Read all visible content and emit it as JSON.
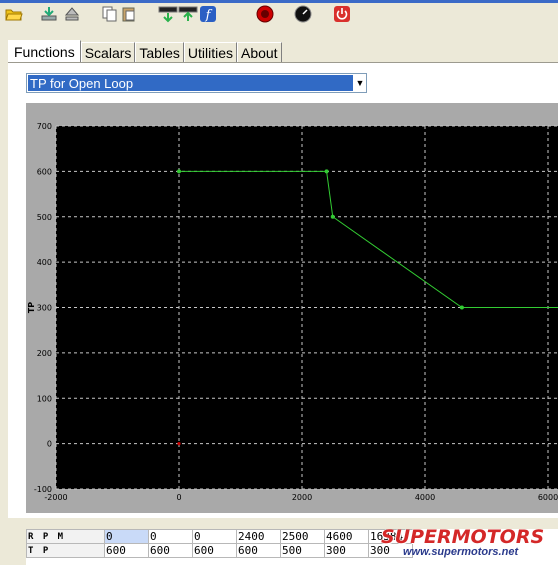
{
  "toolbar": {
    "buttons": [
      {
        "name": "open-folder",
        "icon": "folder-open-icon"
      },
      {
        "name": "download",
        "icon": "download-icon"
      },
      {
        "name": "eject",
        "icon": "eject-icon"
      },
      {
        "name": "copy",
        "icon": "copy-icon"
      },
      {
        "name": "paste",
        "icon": "paste-icon"
      },
      {
        "name": "program-chip",
        "icon": "chip-program-icon"
      },
      {
        "name": "read-chip",
        "icon": "chip-read-icon"
      },
      {
        "name": "function",
        "icon": "function-f-icon"
      },
      {
        "name": "stop",
        "icon": "stop-icon"
      },
      {
        "name": "gauge",
        "icon": "gauge-icon"
      },
      {
        "name": "power",
        "icon": "power-icon"
      }
    ]
  },
  "tabs": [
    {
      "label": "Functions",
      "active": true
    },
    {
      "label": "Scalars",
      "active": false
    },
    {
      "label": "Tables",
      "active": false
    },
    {
      "label": "Utilities",
      "active": false
    },
    {
      "label": "About",
      "active": false
    }
  ],
  "selector": {
    "value": "TP for Open Loop"
  },
  "chart_data": {
    "type": "line",
    "ylabel": "TP",
    "xlim": [
      -2000,
      6000
    ],
    "ylim": [
      -100,
      700
    ],
    "xticks": [
      "-2000",
      "0",
      "2000",
      "4000",
      "6000"
    ],
    "yticks": [
      "-100",
      "0",
      "100",
      "200",
      "300",
      "400",
      "500",
      "600",
      "700"
    ],
    "grid": true,
    "background": "#000000",
    "line_color": "#33cc33",
    "series": [
      {
        "points": [
          {
            "x": 0,
            "y": 600
          },
          {
            "x": 2400,
            "y": 600
          },
          {
            "x": 2500,
            "y": 500
          },
          {
            "x": 4600,
            "y": 300
          },
          {
            "x": 16384,
            "y": 300
          }
        ]
      }
    ],
    "origin_marker": {
      "x": 0,
      "y": 0,
      "color": "#cc0000"
    }
  },
  "table": {
    "rows": [
      {
        "label": "RPM",
        "values": [
          "0",
          "0",
          "0",
          "2400",
          "2500",
          "4600",
          "16384"
        ]
      },
      {
        "label": "TP",
        "values": [
          "600",
          "600",
          "600",
          "600",
          "500",
          "300",
          "300"
        ]
      }
    ],
    "selected_cell": {
      "row": 0,
      "col": 0
    }
  },
  "watermark": {
    "logo": "SUPERMOTORS",
    "url": "www.supermotors.net"
  }
}
